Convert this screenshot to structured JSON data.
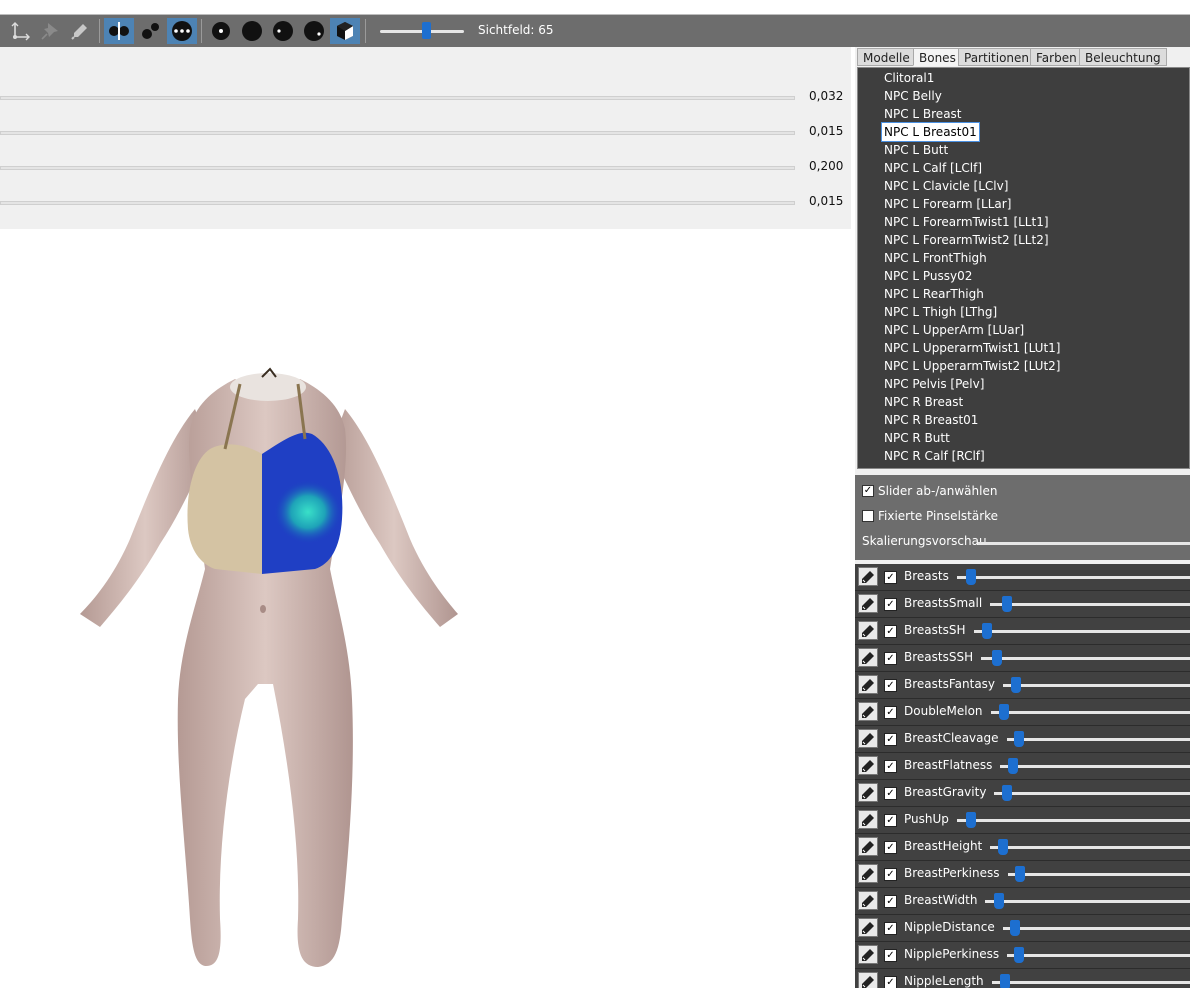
{
  "toolbar": {
    "fov_label": "Sichtfeld: 65",
    "fov_value": 65,
    "buttons": [
      "transform-icon",
      "pin-icon",
      "brush-icon",
      "mirror-icon",
      "vertex-cluster-icon",
      "three-dots-icon",
      "dot-small-icon",
      "dot-large-icon",
      "dot-half-icon",
      "dot-offset-icon",
      "cube-icon"
    ]
  },
  "value_sliders": [
    {
      "value": "0,032"
    },
    {
      "value": "0,015"
    },
    {
      "value": "0,200"
    },
    {
      "value": "0,015"
    }
  ],
  "tabs": [
    "Modelle",
    "Bones",
    "Partitionen",
    "Farben",
    "Beleuchtung"
  ],
  "active_tab": "Bones",
  "bones": [
    "Clitoral1",
    "NPC Belly",
    "NPC L Breast",
    "NPC L Breast01",
    "NPC L Butt",
    "NPC L Calf [LClf]",
    "NPC L Clavicle [LClv]",
    "NPC L Forearm [LLar]",
    "NPC L ForearmTwist1 [LLt1]",
    "NPC L ForearmTwist2 [LLt2]",
    "NPC L FrontThigh",
    "NPC L Pussy02",
    "NPC L RearThigh",
    "NPC L Thigh [LThg]",
    "NPC L UpperArm [LUar]",
    "NPC L UpperarmTwist1 [LUt1]",
    "NPC L UpperarmTwist2 [LUt2]",
    "NPC Pelvis [Pelv]",
    "NPC R Breast",
    "NPC R Breast01",
    "NPC R Butt",
    "NPC R Calf [RClf]"
  ],
  "selected_bone": "NPC L Breast01",
  "options": {
    "toggle_sliders": "Slider ab-/anwählen",
    "toggle_sliders_checked": true,
    "fixed_brush": "Fixierte Pinselstärke",
    "fixed_brush_checked": false,
    "scale_preview": "Skalierungsvorschau"
  },
  "sliders": [
    {
      "name": "Breasts",
      "level": 0.04
    },
    {
      "name": "BreastsSmall",
      "level": 0.06
    },
    {
      "name": "BreastsSH",
      "level": 0.04
    },
    {
      "name": "BreastsSSH",
      "level": 0.05
    },
    {
      "name": "BreastsFantasy",
      "level": 0.04
    },
    {
      "name": "DoubleMelon",
      "level": 0.04
    },
    {
      "name": "BreastCleavage",
      "level": 0.04
    },
    {
      "name": "BreastFlatness",
      "level": 0.04
    },
    {
      "name": "BreastGravity",
      "level": 0.04
    },
    {
      "name": "PushUp",
      "level": 0.04
    },
    {
      "name": "BreastHeight",
      "level": 0.04
    },
    {
      "name": "BreastPerkiness",
      "level": 0.04
    },
    {
      "name": "BreastWidth",
      "level": 0.04
    },
    {
      "name": "NippleDistance",
      "level": 0.04
    },
    {
      "name": "NipplePerkiness",
      "level": 0.04
    },
    {
      "name": "NippleLength",
      "level": 0.04
    }
  ],
  "colors": {
    "accent": "#1d6fd0",
    "toolbar": "#6d6d6d",
    "list_bg": "#3e3e3e"
  }
}
